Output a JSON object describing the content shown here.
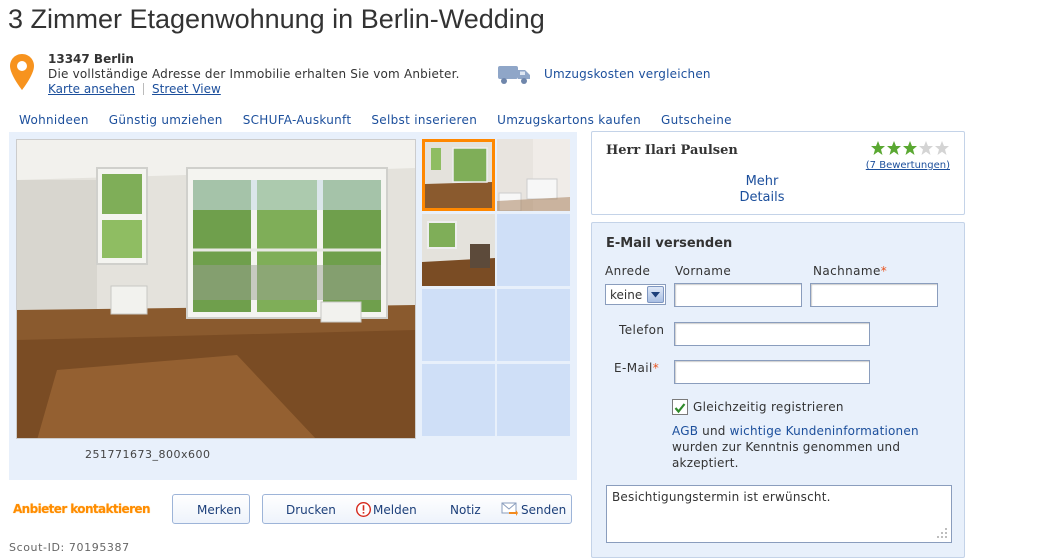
{
  "page": {
    "title": "3 Zimmer Etagenwohnung in Berlin-Wedding",
    "colors": {
      "link": "#1c4f9c",
      "accent": "#ff8800",
      "panel": "#e8f0fb",
      "star": "#5aa832"
    }
  },
  "address": {
    "zip_city": "13347 Berlin",
    "hint": "Die vollständige Adresse der Immobilie erhalten Sie vom Anbieter.",
    "map_link": "Karte ansehen",
    "streetview_link": "Street View",
    "icon": "map-pin-icon"
  },
  "moving": {
    "label": "Umzugskosten vergleichen",
    "icon": "moving-truck-icon"
  },
  "nav": [
    "Wohnideen",
    "Günstig umziehen",
    "SCHUFA-Auskunft",
    "Selbst inserieren",
    "Umzugskartons kaufen",
    "Gutscheine"
  ],
  "gallery": {
    "caption": "251771673_800x600",
    "thumbnails": [
      "living-room",
      "bathroom",
      "room",
      "",
      "",
      "",
      "",
      ""
    ],
    "selected_index": 0
  },
  "actions": {
    "contact": "Anbieter kontaktieren",
    "save": "Merken",
    "print": "Drucken",
    "report": "Melden",
    "note": "Notiz",
    "send": "Senden"
  },
  "scout_id": "Scout-ID: 70195387",
  "agent": {
    "name": "Herr Ilari Paulsen",
    "rating": 3,
    "rating_max": 5,
    "ratings_link": "(7 Bewertungen)",
    "details_line1": "Mehr",
    "details_line2": "Details"
  },
  "mail_form": {
    "heading": "E-Mail versenden",
    "salutation_label": "Anrede",
    "salutation_value": "keine",
    "firstname_label": "Vorname",
    "lastname_label": "Nachname",
    "phone_label": "Telefon",
    "email_label": "E-Mail",
    "required_mark": "*",
    "register_label": "Gleichzeitig registrieren",
    "register_checked": true,
    "agb_link": "AGB",
    "agb_and": "und",
    "kunden_link": "wichtige Kundeninformationen",
    "agb_text": "wurden zur Kenntnis genommen und akzeptiert.",
    "message": "Besichtigungstermin ist erwünscht."
  }
}
